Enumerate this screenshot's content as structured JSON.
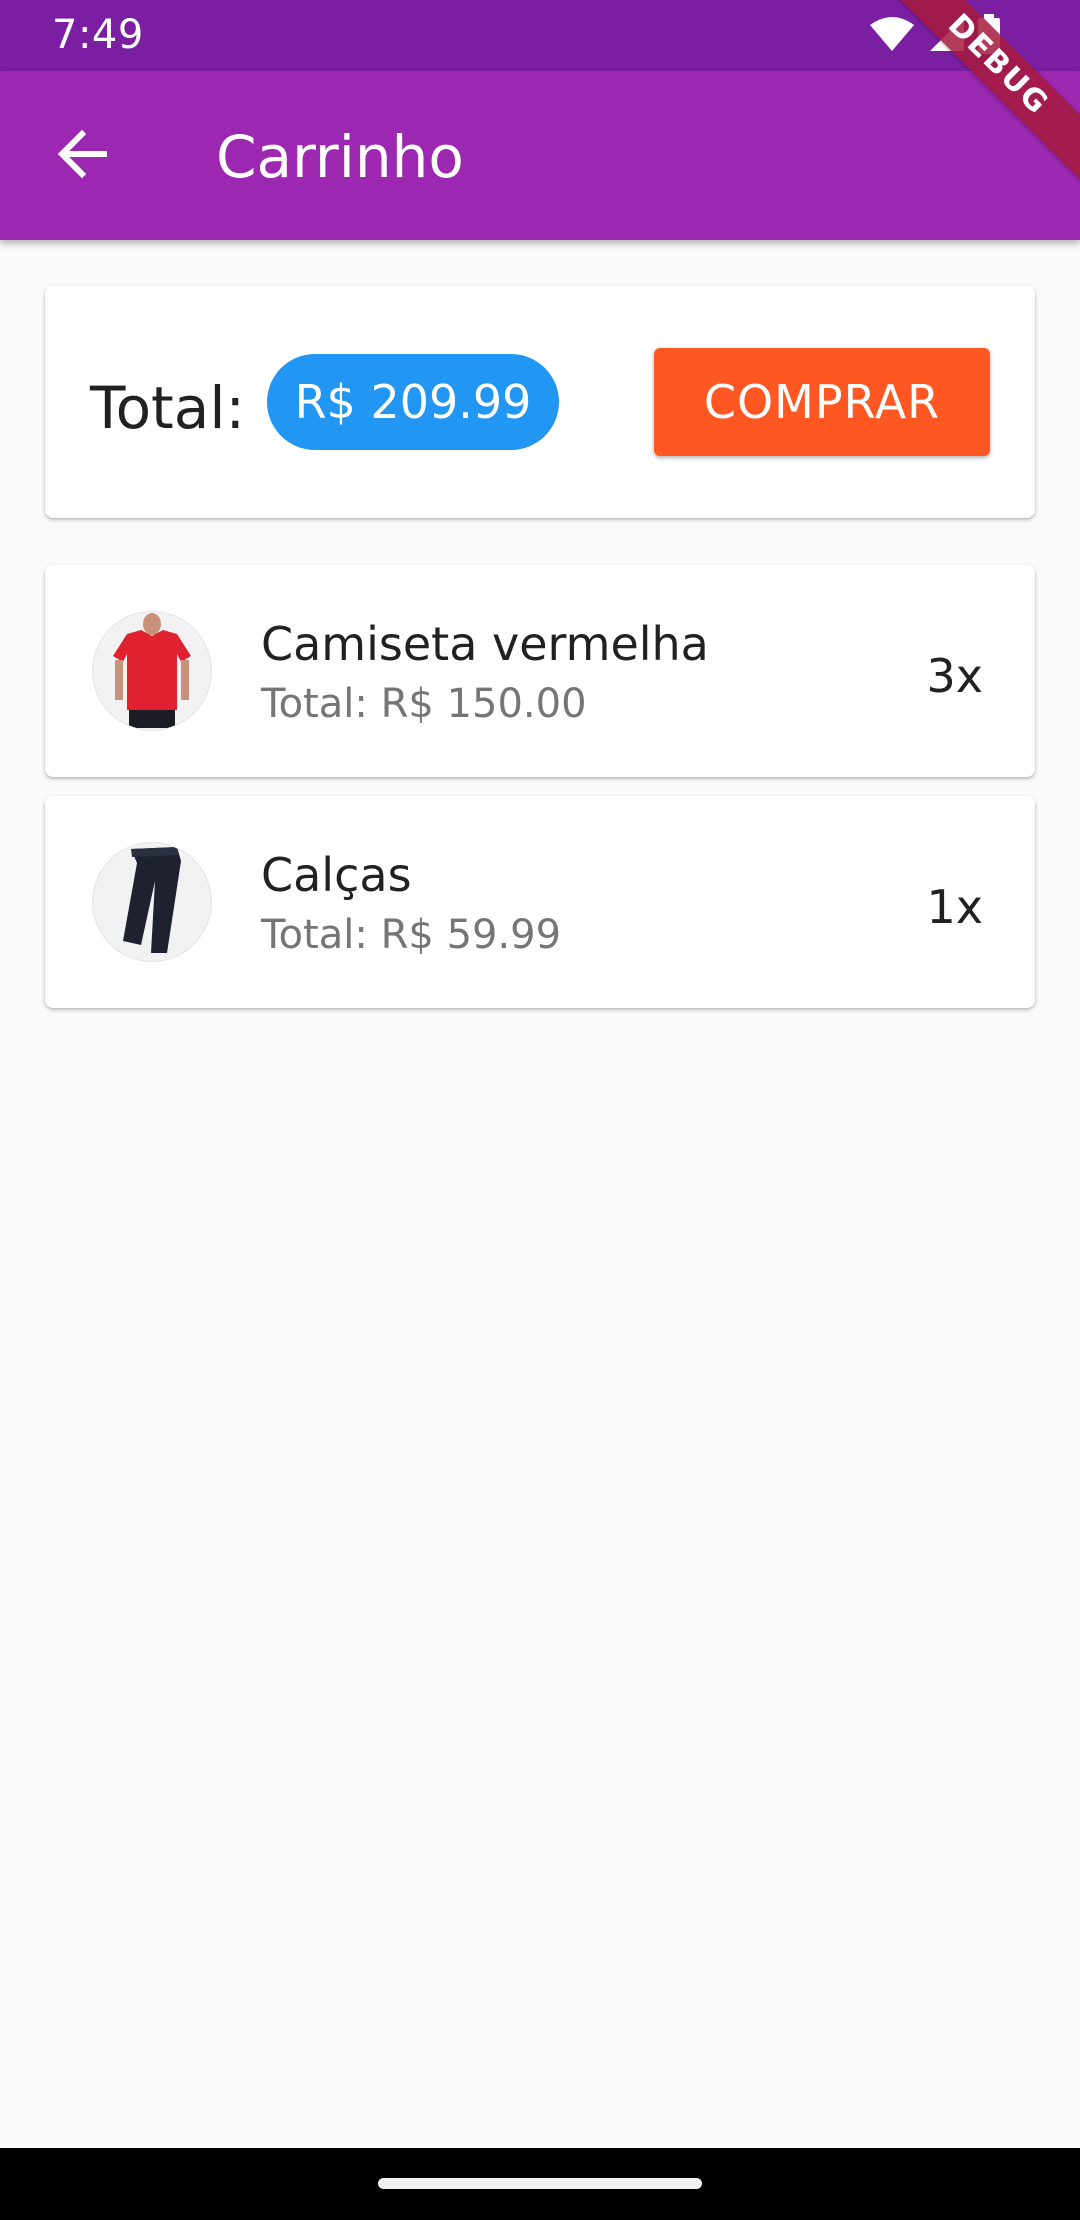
{
  "status_bar": {
    "time": "7:49",
    "icons": [
      "wifi-icon",
      "cell-signal-icon",
      "battery-icon"
    ]
  },
  "debug_banner": "DEBUG",
  "app_bar": {
    "title": "Carrinho",
    "back_icon": "arrow-back-icon"
  },
  "summary": {
    "total_label": "Total:",
    "total_value": "R$ 209.99",
    "buy_label": "COMPRAR"
  },
  "items": [
    {
      "name": "Camiseta vermelha",
      "subtotal": "Total: R$ 150.00",
      "quantity": "3x",
      "image": "red-tshirt-image"
    },
    {
      "name": "Calças",
      "subtotal": "Total: R$ 59.99",
      "quantity": "1x",
      "image": "black-pants-image"
    }
  ],
  "colors": {
    "status_bar": "#7b1fa2",
    "app_bar": "#9c27b0",
    "total_chip": "#2196f3",
    "buy_button": "#ff5722",
    "background": "#fafafa"
  }
}
